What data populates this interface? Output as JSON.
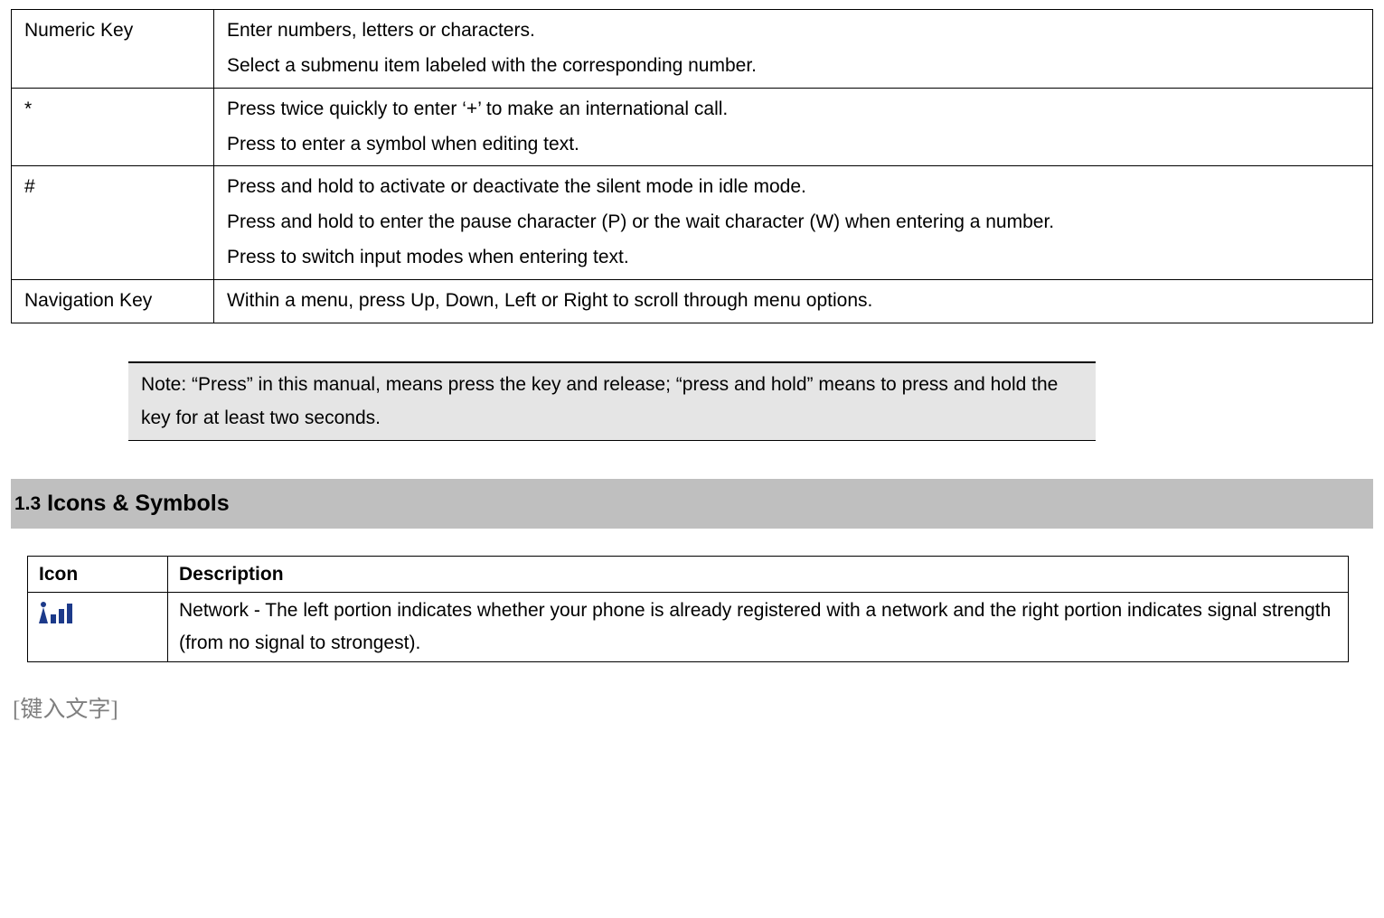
{
  "keys_table": {
    "rows": [
      {
        "key": "Numeric Key",
        "desc_lines": [
          "Enter numbers, letters or characters.",
          "Select a submenu item labeled with the corresponding number."
        ]
      },
      {
        "key": "*",
        "desc_lines": [
          "Press twice quickly to enter ‘+’ to make an international call.",
          "Press to enter a symbol when editing text."
        ]
      },
      {
        "key": "#",
        "desc_lines": [
          "Press and hold to activate or deactivate the silent mode in idle mode.",
          "Press and hold to enter the pause character (P) or the wait character (W) when entering a number.",
          "Press to switch input modes when entering text."
        ]
      },
      {
        "key": "Navigation Key",
        "desc_lines": [
          "Within a menu, press Up, Down, Left or Right to scroll through menu options."
        ]
      }
    ]
  },
  "note": "Note: “Press” in this manual, means press the key and release; “press and hold” means to press and hold the key for at least two seconds.",
  "section": {
    "number": "1.3",
    "title": "Icons & Symbols"
  },
  "icons_table": {
    "headers": {
      "icon": "Icon",
      "description": "Description"
    },
    "rows": [
      {
        "icon_name": "network-signal-icon",
        "description": "Network - The left portion indicates whether your phone is already registered with a network and the right portion indicates signal strength (from no signal to strongest)."
      }
    ]
  },
  "footer": "[键入文字]"
}
